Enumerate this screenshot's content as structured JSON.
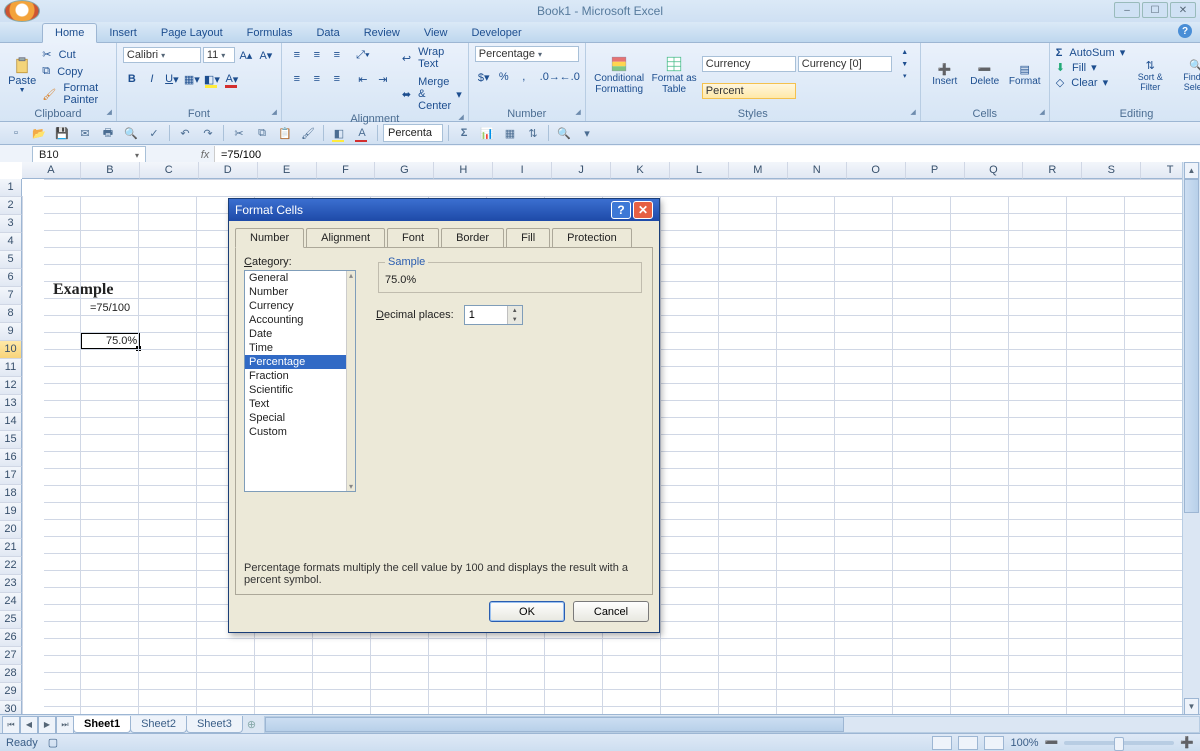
{
  "title": "Book1 - Microsoft Excel",
  "tabs": [
    "Home",
    "Insert",
    "Page Layout",
    "Formulas",
    "Data",
    "Review",
    "View",
    "Developer"
  ],
  "active_tab": 0,
  "ribbon": {
    "clipboard": {
      "label": "Clipboard",
      "paste": "Paste",
      "cut": "Cut",
      "copy": "Copy",
      "painter": "Format Painter"
    },
    "font": {
      "label": "Font",
      "name": "Calibri",
      "size": "11"
    },
    "alignment": {
      "label": "Alignment",
      "wrap": "Wrap Text",
      "merge": "Merge & Center"
    },
    "number": {
      "label": "Number",
      "format": "Percentage"
    },
    "styles": {
      "label": "Styles",
      "cond": "Conditional Formatting",
      "table": "Format as Table",
      "gallery": [
        "Currency",
        "Currency [0]",
        "Percent"
      ]
    },
    "cells": {
      "label": "Cells",
      "insert": "Insert",
      "delete": "Delete",
      "format": "Format"
    },
    "editing": {
      "label": "Editing",
      "autosum": "AutoSum",
      "fill": "Fill",
      "clear": "Clear",
      "sort": "Sort & Filter",
      "find": "Find & Select"
    }
  },
  "qat_box": "Percenta",
  "namebox": "B10",
  "formula": "=75/100",
  "columns": [
    "A",
    "B",
    "C",
    "D",
    "E",
    "F",
    "G",
    "H",
    "I",
    "J",
    "K",
    "L",
    "M",
    "N",
    "O",
    "P",
    "Q",
    "R",
    "S",
    "T"
  ],
  "row_count": 31,
  "selected_row": 10,
  "cells": {
    "example_label": "Example",
    "formula_text": "=75/100",
    "b10_value": "75.0%"
  },
  "sheets": [
    "Sheet1",
    "Sheet2",
    "Sheet3"
  ],
  "active_sheet": 0,
  "status": {
    "ready": "Ready",
    "zoom": "100%"
  },
  "dialog": {
    "title": "Format Cells",
    "tabs": [
      "Number",
      "Alignment",
      "Font",
      "Border",
      "Fill",
      "Protection"
    ],
    "active_tab": 0,
    "category_label": "Category:",
    "categories": [
      "General",
      "Number",
      "Currency",
      "Accounting",
      "Date",
      "Time",
      "Percentage",
      "Fraction",
      "Scientific",
      "Text",
      "Special",
      "Custom"
    ],
    "selected_category": "Percentage",
    "sample_label": "Sample",
    "sample_value": "75.0%",
    "decimal_label": "Decimal places:",
    "decimal_value": "1",
    "description": "Percentage formats multiply the cell value by 100 and displays the result with a percent symbol.",
    "ok": "OK",
    "cancel": "Cancel"
  }
}
